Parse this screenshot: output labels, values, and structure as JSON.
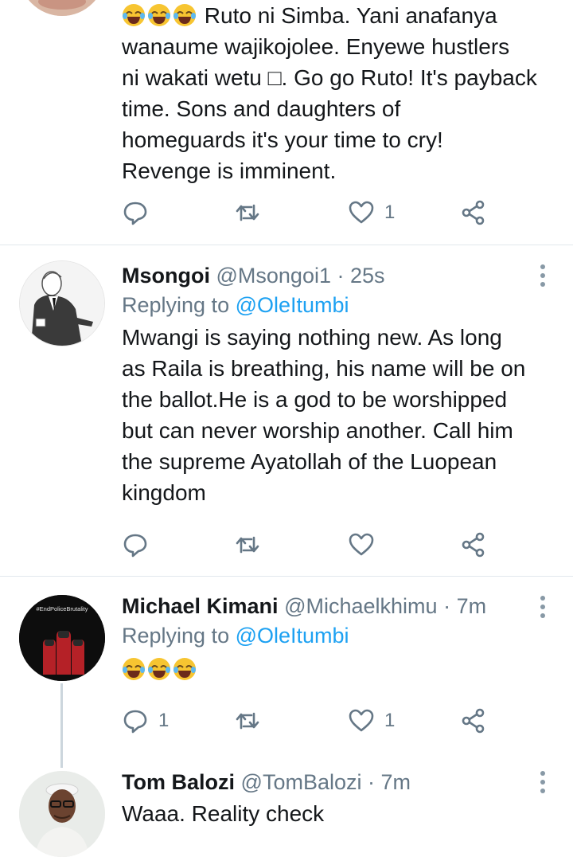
{
  "colors": {
    "accent": "#1da1f2",
    "muted": "#657786",
    "text": "#14171a",
    "divider": "#e1e8ed"
  },
  "tweets": [
    {
      "lines": [
        "Ruto ni Simba. Yani anafanya",
        "wanaume wajikojolee. Enyewe hustlers",
        "ni wakati wetu □. Go go Ruto! It's payback",
        "time. Sons and daughters of",
        "homeguards it's your time to cry!",
        "Revenge is imminent."
      ],
      "emoji_prefix": [
        "joy-emoji",
        "joy-emoji",
        "joy-emoji"
      ],
      "actions": {
        "reply_count": "",
        "retweet_count": "",
        "like_count": "1"
      }
    },
    {
      "name": "Msongoi",
      "handle": "@Msongoi1",
      "sep": "·",
      "time": "25s",
      "replying_prefix": "Replying to",
      "replying_handle": "@OleItumbi",
      "lines": [
        "Mwangi is saying nothing new. As long",
        "as Raila is breathing, his name will be on",
        "the ballot.He is a god to be worshipped",
        "but can never worship another. Call him",
        "the supreme Ayatollah of the Luopean",
        "kingdom"
      ],
      "actions": {
        "reply_count": "",
        "retweet_count": "",
        "like_count": ""
      }
    },
    {
      "name": "Michael Kimani",
      "handle": "@Michaelkhimu",
      "sep": "·",
      "time": "7m",
      "replying_prefix": "Replying to",
      "replying_handle": "@OleItumbi",
      "avatar_text": "#EndPoliceBrutality",
      "emoji_body": [
        "joy-emoji",
        "joy-emoji",
        "joy-emoji"
      ],
      "actions": {
        "reply_count": "1",
        "retweet_count": "",
        "like_count": "1"
      }
    },
    {
      "name": "Tom Balozi",
      "handle": "@TomBalozi",
      "sep": "·",
      "time": "7m",
      "text": "Waaa. Reality check"
    }
  ]
}
